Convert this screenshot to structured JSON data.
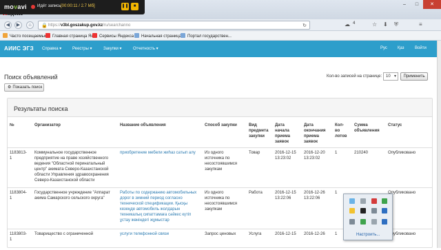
{
  "recorder": {
    "brand_prefix": "mo",
    "brand_suffix": "vavi",
    "status_label": "Идёт запись",
    "time_size": "[00:00:11 / 2.7 Мб]"
  },
  "browser": {
    "yandex_logo_y": "Я",
    "yandex_logo_rest": "ндекс",
    "url_scheme": "https://",
    "url_domain": "v3bl.goszakup.gov.kz",
    "url_path": "/ru/searchanno",
    "badge_count": "4",
    "bookmarks": [
      "Часто посещаемые",
      "Главная страница Ян...",
      "Сервисы Яндекса",
      "Начальная страница",
      "Портал государствен..."
    ]
  },
  "site": {
    "title": "АИИС ЭГЗ",
    "menu": [
      "Справка ▾",
      "Реестры ▾",
      "Закупки ▾",
      "Отчетность ▾"
    ],
    "lang_ru": "Рус",
    "lang_kz": "Қаз",
    "login": "Войти"
  },
  "page": {
    "title": "Поиск объявлений",
    "records_label": "Кол-во записей на странице:",
    "records_value": "10",
    "apply_label": "Применить",
    "show_search_label": "Показать поиск",
    "results_title": "Результаты поиска"
  },
  "table": {
    "headers": [
      "№",
      "Организатор",
      "Название объявления",
      "Способ закупки",
      "Вид предмета закупки",
      "Дата начала приема заявок",
      "Дата окончания приема заявок",
      "Кол-во лотов",
      "Сумма объявления",
      "Статус"
    ],
    "rows": [
      {
        "num": "1183813-1",
        "org": "Коммунальное государственное предприятие на праве хозяйственного ведения \"Областной перинатальный центр\" акимата Северо-Казахстанской области Управления здравоохранения Северо-Казахстанской области",
        "name": "приобретение мебели жиһаз сатып алу",
        "method": "Из одного источника по несостоявшимся закупкам",
        "subject": "Товар",
        "start": "2016-12-15 13:23:02",
        "end": "2016-12-20 13:23:02",
        "lots": "1",
        "sum": "210240",
        "status": "Опубликовано"
      },
      {
        "num": "1183804-1",
        "org": "Государственное учреждение \"Аппарат акима Самарского сельского округа\"",
        "name": "Работы по содержанию автомобильных дорог в зимний период согласно технической спецификации. Қысқы кезеңде автомобиль жолдарын техникалық сипаттамаға сәйкес күтіп ұстау жөніндегі жұмыстар",
        "method": "Из одного источника по несостоявшимся закупкам",
        "subject": "Работа",
        "start": "2016-12-15 13:22:06",
        "end": "2016-12-26 13:22:06",
        "lots": "1",
        "sum": "",
        "status": "Опубликовано"
      },
      {
        "num": "1183803-1",
        "org": "Товарищество с ограниченной",
        "name": "услуги телефонной связи",
        "method": "Запрос ценовых",
        "subject": "Услуга",
        "start": "2016-12-15",
        "end": "2016-12-26",
        "lots": "1",
        "sum": "",
        "status": "Опубликовано"
      }
    ]
  },
  "tray": {
    "customize_label": "Настроить...",
    "colors": {
      "green": "#3fa34d",
      "red": "#d43b3b",
      "blue": "#2f6fc1",
      "gray": "#7d8a96",
      "yellow": "#f2c230"
    }
  }
}
